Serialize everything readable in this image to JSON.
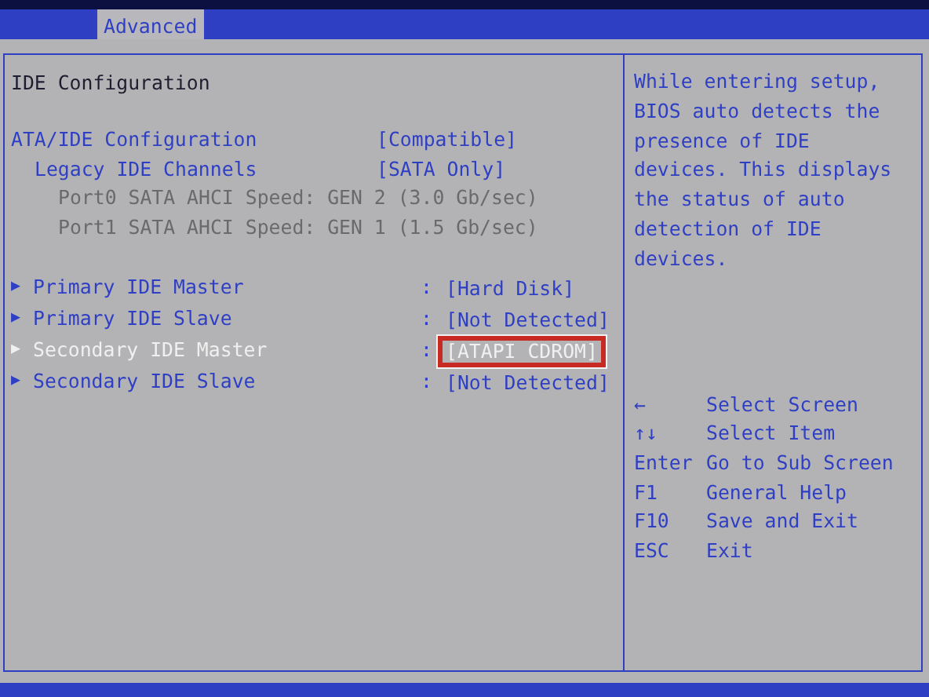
{
  "tabs": [
    {
      "label": "Advanced",
      "selected": true
    }
  ],
  "section_title": "IDE Configuration",
  "settings": [
    {
      "kind": "option",
      "label": "ATA/IDE Configuration",
      "value": "[Compatible]",
      "children": [
        {
          "kind": "option",
          "label": "Legacy IDE Channels",
          "value": "[SATA Only]",
          "children": [
            {
              "kind": "info",
              "label": "Port0 SATA AHCI Speed: GEN 2 (3.0 Gb/sec)"
            },
            {
              "kind": "info",
              "label": "Port1 SATA AHCI Speed: GEN 1 (1.5 Gb/sec)"
            }
          ]
        }
      ]
    }
  ],
  "devices": [
    {
      "marker": "▶",
      "label": "Primary IDE Master",
      "separator": ":",
      "value": "[Hard Disk]",
      "selected": false,
      "highlighted": false
    },
    {
      "marker": "▶",
      "label": "Primary IDE Slave",
      "separator": ":",
      "value": "[Not Detected]",
      "selected": false,
      "highlighted": false
    },
    {
      "marker": "▶",
      "label": "Secondary IDE Master",
      "separator": ":",
      "value": "[ATAPI CDROM]",
      "selected": true,
      "highlighted": true
    },
    {
      "marker": "▶",
      "label": "Secondary IDE Slave",
      "separator": ":",
      "value": "[Not Detected]",
      "selected": false,
      "highlighted": false
    }
  ],
  "help_text": "While entering setup, BIOS auto detects the presence of IDE devices. This displays the status of auto detection of IDE devices.",
  "keys": [
    {
      "key": "←",
      "action": "Select Screen"
    },
    {
      "key": "↑↓",
      "action": "Select Item"
    },
    {
      "key": "Enter",
      "action": "Go to Sub Screen"
    },
    {
      "key": "F1",
      "action": "General Help"
    },
    {
      "key": "F10",
      "action": "Save and Exit"
    },
    {
      "key": "ESC",
      "action": "Exit"
    }
  ]
}
